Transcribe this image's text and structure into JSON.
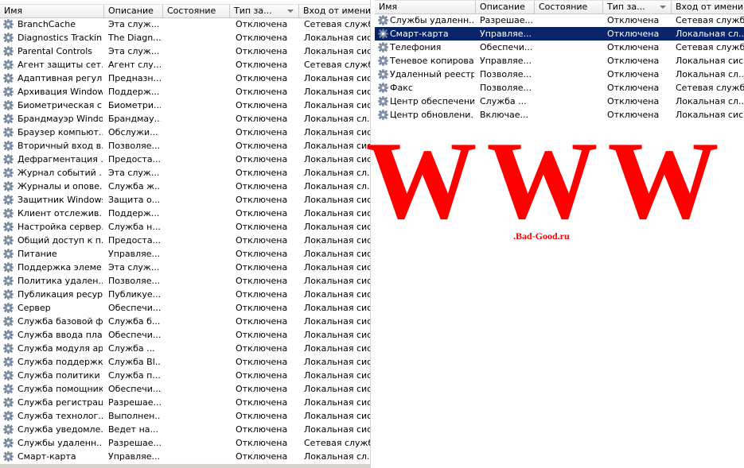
{
  "columns": {
    "name": "Имя",
    "description": "Описание",
    "status": "Состояние",
    "startup_type": "Тип за...",
    "logon_as": "Вход от имени"
  },
  "left_pane": {
    "rows": [
      {
        "name": "BranchCache",
        "description": "Эта служ...",
        "status": "",
        "startup_type": "Отключена",
        "logon_as": "Сетевая служба"
      },
      {
        "name": "Diagnostics Trackin...",
        "description": "The Diagn...",
        "status": "",
        "startup_type": "Отключена",
        "logon_as": "Локальная сис..."
      },
      {
        "name": "Parental Controls",
        "description": "Эта служ...",
        "status": "",
        "startup_type": "Отключена",
        "logon_as": "Локальная сис..."
      },
      {
        "name": "Агент защиты сет...",
        "description": "Агент слу...",
        "status": "",
        "startup_type": "Отключена",
        "logon_as": "Сетевая служба"
      },
      {
        "name": "Адаптивная регул...",
        "description": "Предназн...",
        "status": "",
        "startup_type": "Отключена",
        "logon_as": "Локальная сис..."
      },
      {
        "name": "Архивация Windows",
        "description": "Поддерж...",
        "status": "",
        "startup_type": "Отключена",
        "logon_as": "Локальная сис..."
      },
      {
        "name": "Биометрическая с...",
        "description": "Биометри...",
        "status": "",
        "startup_type": "Отключена",
        "logon_as": "Локальная сис..."
      },
      {
        "name": "Брандмауэр Windows",
        "description": "Брандмау...",
        "status": "",
        "startup_type": "Отключена",
        "logon_as": "Локальная сл..."
      },
      {
        "name": "Браузер компьют...",
        "description": "Обслужи...",
        "status": "",
        "startup_type": "Отключена",
        "logon_as": "Локальная сис..."
      },
      {
        "name": "Вторичный вход в...",
        "description": "Позволяе...",
        "status": "",
        "startup_type": "Отключена",
        "logon_as": "Локальная сис..."
      },
      {
        "name": "Дефрагментация ...",
        "description": "Предоста...",
        "status": "",
        "startup_type": "Отключена",
        "logon_as": "Локальная сис..."
      },
      {
        "name": "Журнал событий ...",
        "description": "Эта служ...",
        "status": "",
        "startup_type": "Отключена",
        "logon_as": "Локальная сл..."
      },
      {
        "name": "Журналы и опове...",
        "description": "Служба ж...",
        "status": "",
        "startup_type": "Отключена",
        "logon_as": "Локальная сл..."
      },
      {
        "name": "Защитник Windows",
        "description": "Защита о...",
        "status": "",
        "startup_type": "Отключена",
        "logon_as": "Локальная сис..."
      },
      {
        "name": "Клиент отслежив...",
        "description": "Поддерж...",
        "status": "",
        "startup_type": "Отключена",
        "logon_as": "Локальная сис..."
      },
      {
        "name": "Настройка сервер...",
        "description": "Служба н...",
        "status": "",
        "startup_type": "Отключена",
        "logon_as": "Локальная сис..."
      },
      {
        "name": "Общий доступ к п...",
        "description": "Предоста...",
        "status": "",
        "startup_type": "Отключена",
        "logon_as": "Локальная сис..."
      },
      {
        "name": "Питание",
        "description": "Управляе...",
        "status": "",
        "startup_type": "Отключена",
        "logon_as": "Локальная сис..."
      },
      {
        "name": "Поддержка элеме...",
        "description": "Эта служ...",
        "status": "",
        "startup_type": "Отключена",
        "logon_as": "Локальная сис..."
      },
      {
        "name": "Политика удален...",
        "description": "Позволяе...",
        "status": "",
        "startup_type": "Отключена",
        "logon_as": "Локальная сис..."
      },
      {
        "name": "Публикация ресур...",
        "description": "Публикуе...",
        "status": "",
        "startup_type": "Отключена",
        "logon_as": "Локальная сис..."
      },
      {
        "name": "Сервер",
        "description": "Обеспечи...",
        "status": "",
        "startup_type": "Отключена",
        "logon_as": "Локальная сис..."
      },
      {
        "name": "Служба базовой ф...",
        "description": "Служба б...",
        "status": "",
        "startup_type": "Отключена",
        "logon_as": "Локальная сис..."
      },
      {
        "name": "Служба ввода пла...",
        "description": "Обеспечи...",
        "status": "",
        "startup_type": "Отключена",
        "logon_as": "Локальная сис..."
      },
      {
        "name": "Служба модуля ар...",
        "description": "Служба ...",
        "status": "",
        "startup_type": "Отключена",
        "logon_as": "Локальная сис..."
      },
      {
        "name": "Служба поддержк...",
        "description": "Служба Bl...",
        "status": "",
        "startup_type": "Отключена",
        "logon_as": "Локальная сис..."
      },
      {
        "name": "Служба политики ...",
        "description": "Служба п...",
        "status": "",
        "startup_type": "Отключена",
        "logon_as": "Локальная сис..."
      },
      {
        "name": "Служба помощник...",
        "description": "Обеспечи...",
        "status": "",
        "startup_type": "Отключена",
        "logon_as": "Локальная сис..."
      },
      {
        "name": "Служба регистрац...",
        "description": "Разрешае...",
        "status": "",
        "startup_type": "Отключена",
        "logon_as": "Локальная сис..."
      },
      {
        "name": "Служба технолог...",
        "description": "Выполнен...",
        "status": "",
        "startup_type": "Отключена",
        "logon_as": "Локальная сис..."
      },
      {
        "name": "Служба уведомле...",
        "description": "Ведет на...",
        "status": "",
        "startup_type": "Отключена",
        "logon_as": "Локальная сис..."
      },
      {
        "name": "Службы удаленн...",
        "description": "Разрешае...",
        "status": "",
        "startup_type": "Отключена",
        "logon_as": "Сетевая служба"
      },
      {
        "name": "Смарт-карта",
        "description": "Управляе...",
        "status": "",
        "startup_type": "Отключена",
        "logon_as": "Локальная сл..."
      }
    ]
  },
  "right_pane": {
    "selected_index": 1,
    "rows": [
      {
        "name": "Службы удаленн...",
        "description": "Разрешае...",
        "status": "",
        "startup_type": "Отключена",
        "logon_as": "Сетевая служба"
      },
      {
        "name": "Смарт-карта",
        "description": "Управляе...",
        "status": "",
        "startup_type": "Отключена",
        "logon_as": "Локальная сл..."
      },
      {
        "name": "Телефония",
        "description": "Обеспечи...",
        "status": "",
        "startup_type": "Отключена",
        "logon_as": "Сетевая служба"
      },
      {
        "name": "Теневое копирова...",
        "description": "Управляе...",
        "status": "",
        "startup_type": "Отключена",
        "logon_as": "Локальная сис..."
      },
      {
        "name": "Удаленный реестр",
        "description": "Позволяе...",
        "status": "",
        "startup_type": "Отключена",
        "logon_as": "Локальная сл..."
      },
      {
        "name": "Факс",
        "description": "Позволяе...",
        "status": "",
        "startup_type": "Отключена",
        "logon_as": "Сетевая служба"
      },
      {
        "name": "Центр обеспечени...",
        "description": "Служба ...",
        "status": "",
        "startup_type": "Отключена",
        "logon_as": "Локальная сл..."
      },
      {
        "name": "Центр обновлени...",
        "description": "Включае...",
        "status": "",
        "startup_type": "Отключена",
        "logon_as": "Локальная сис..."
      }
    ]
  },
  "watermark": {
    "text": "WWW",
    "url": ".Bad-Good.ru",
    "color": "#ff0000"
  },
  "icons": {
    "service": "gear-icon",
    "sort": "sort-down-icon"
  },
  "colors": {
    "selection": "#0a246a",
    "header": "#ececec"
  }
}
